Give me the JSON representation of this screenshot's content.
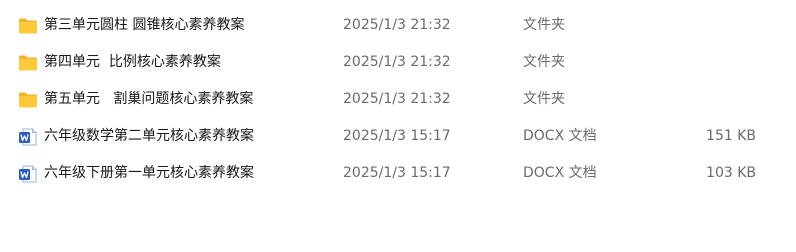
{
  "files": [
    {
      "name": "第三单元圆柱 圆锥核心素养教案",
      "modified": "2025/1/3 21:32",
      "type": "文件夹",
      "size": "",
      "icon": "folder-icon"
    },
    {
      "name": "第四单元  比例核心素养教案",
      "modified": "2025/1/3 21:32",
      "type": "文件夹",
      "size": "",
      "icon": "folder-icon"
    },
    {
      "name": "第五单元   割巢问题核心素养教案",
      "modified": "2025/1/3 21:32",
      "type": "文件夹",
      "size": "",
      "icon": "folder-icon"
    },
    {
      "name": "六年级数学第二单元核心素养教案",
      "modified": "2025/1/3 15:17",
      "type": "DOCX 文档",
      "size": "151 KB",
      "icon": "word-doc-icon"
    },
    {
      "name": "六年级下册第一单元核心素养教案",
      "modified": "2025/1/3 15:17",
      "type": "DOCX 文档",
      "size": "103 KB",
      "icon": "word-doc-icon"
    }
  ],
  "colors": {
    "folder_body": "#FFC93C",
    "folder_tab": "#F2B52A",
    "word_blue": "#2B5EB8"
  }
}
